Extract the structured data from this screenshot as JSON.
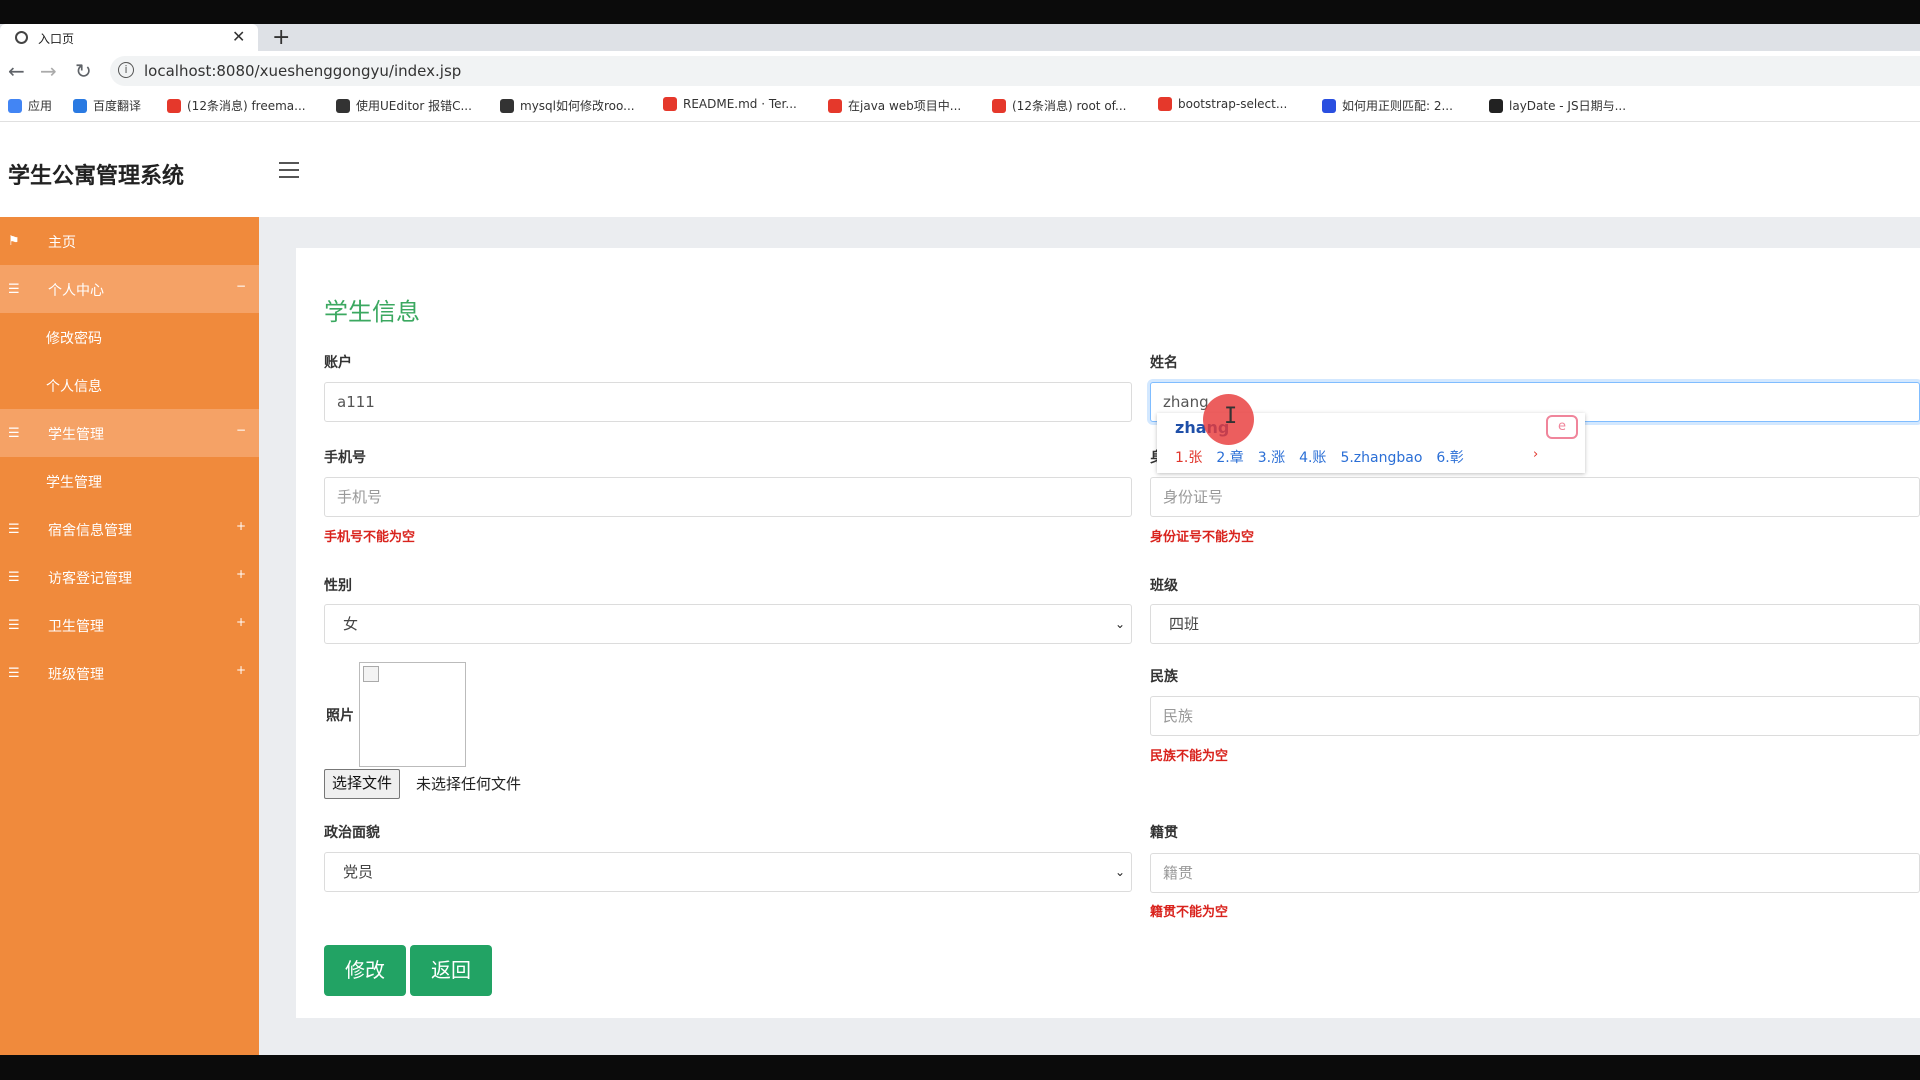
{
  "browser": {
    "tab_title": "入口页",
    "tab_close": "✕",
    "new_tab": "+",
    "url": "localhost:8080/xueshenggongyu/index.jsp",
    "bookmarks": [
      {
        "label": "应用",
        "color": "#4285f4"
      },
      {
        "label": "百度翻译",
        "color": "#2a7ae2"
      },
      {
        "label": "(12条消息) freema...",
        "color": "#e5382b"
      },
      {
        "label": "使用UEditor 报错C...",
        "color": "#333333"
      },
      {
        "label": "mysql如何修改roo...",
        "color": "#333333"
      },
      {
        "label": "README.md · Ter...",
        "color": "#e5382b"
      },
      {
        "label": "在java web项目中...",
        "color": "#e5382b"
      },
      {
        "label": "(12条消息) root of...",
        "color": "#e5382b"
      },
      {
        "label": "bootstrap-select...",
        "color": "#e5382b"
      },
      {
        "label": "如何用正则匹配: 2...",
        "color": "#2a4fe0"
      },
      {
        "label": "layDate - JS日期与...",
        "color": "#222222"
      }
    ]
  },
  "app": {
    "brand": "学生公寓管理系统"
  },
  "sidebar": {
    "items": [
      {
        "label": "主页",
        "icon": "flag-icon",
        "glyph": "⚑",
        "chevron": ""
      },
      {
        "label": "个人中心",
        "icon": "grid-icon",
        "glyph": "☰",
        "chevron": "−"
      },
      {
        "label": "修改密码",
        "icon": "",
        "glyph": "",
        "chevron": ""
      },
      {
        "label": "个人信息",
        "icon": "",
        "glyph": "",
        "chevron": ""
      },
      {
        "label": "学生管理",
        "icon": "grid-icon",
        "glyph": "☰",
        "chevron": "−"
      },
      {
        "label": "学生管理",
        "icon": "",
        "glyph": "",
        "chevron": ""
      },
      {
        "label": "宿舍信息管理",
        "icon": "grid-icon",
        "glyph": "☰",
        "chevron": "+"
      },
      {
        "label": "访客登记管理",
        "icon": "grid-icon",
        "glyph": "☰",
        "chevron": "+"
      },
      {
        "label": "卫生管理",
        "icon": "grid-icon",
        "glyph": "☰",
        "chevron": "+"
      },
      {
        "label": "班级管理",
        "icon": "grid-icon",
        "glyph": "☰",
        "chevron": "+"
      }
    ]
  },
  "form": {
    "title": "学生信息",
    "account": {
      "label": "账户",
      "value": "a111"
    },
    "name": {
      "label": "姓名",
      "value": "zhang"
    },
    "phone": {
      "label": "手机号",
      "placeholder": "手机号",
      "error": "手机号不能为空"
    },
    "idcard": {
      "label": "身",
      "placeholder": "身份证号",
      "error": "身份证号不能为空"
    },
    "gender": {
      "label": "性别",
      "value": "女"
    },
    "class": {
      "label": "班级",
      "value": "四班"
    },
    "photo": {
      "label": "照片",
      "file_button": "选择文件",
      "file_status": "未选择任何文件"
    },
    "ethnicity": {
      "label": "民族",
      "placeholder": "民族",
      "error": "民族不能为空"
    },
    "political": {
      "label": "政治面貌",
      "value": "党员"
    },
    "native_place": {
      "label": "籍贯",
      "placeholder": "籍贯",
      "error": "籍贯不能为空"
    },
    "submit": "修改",
    "back": "返回"
  },
  "ime": {
    "composition": "zhang",
    "candidates": [
      "1.张",
      "2.章",
      "3.涨",
      "4.账",
      "5.zhangbao",
      "6.彰"
    ],
    "more": "›"
  },
  "colors": {
    "sidebar": "#f08a3c",
    "accent_green": "#22a364",
    "title_green": "#3ba860",
    "error_red": "#d9231d"
  }
}
